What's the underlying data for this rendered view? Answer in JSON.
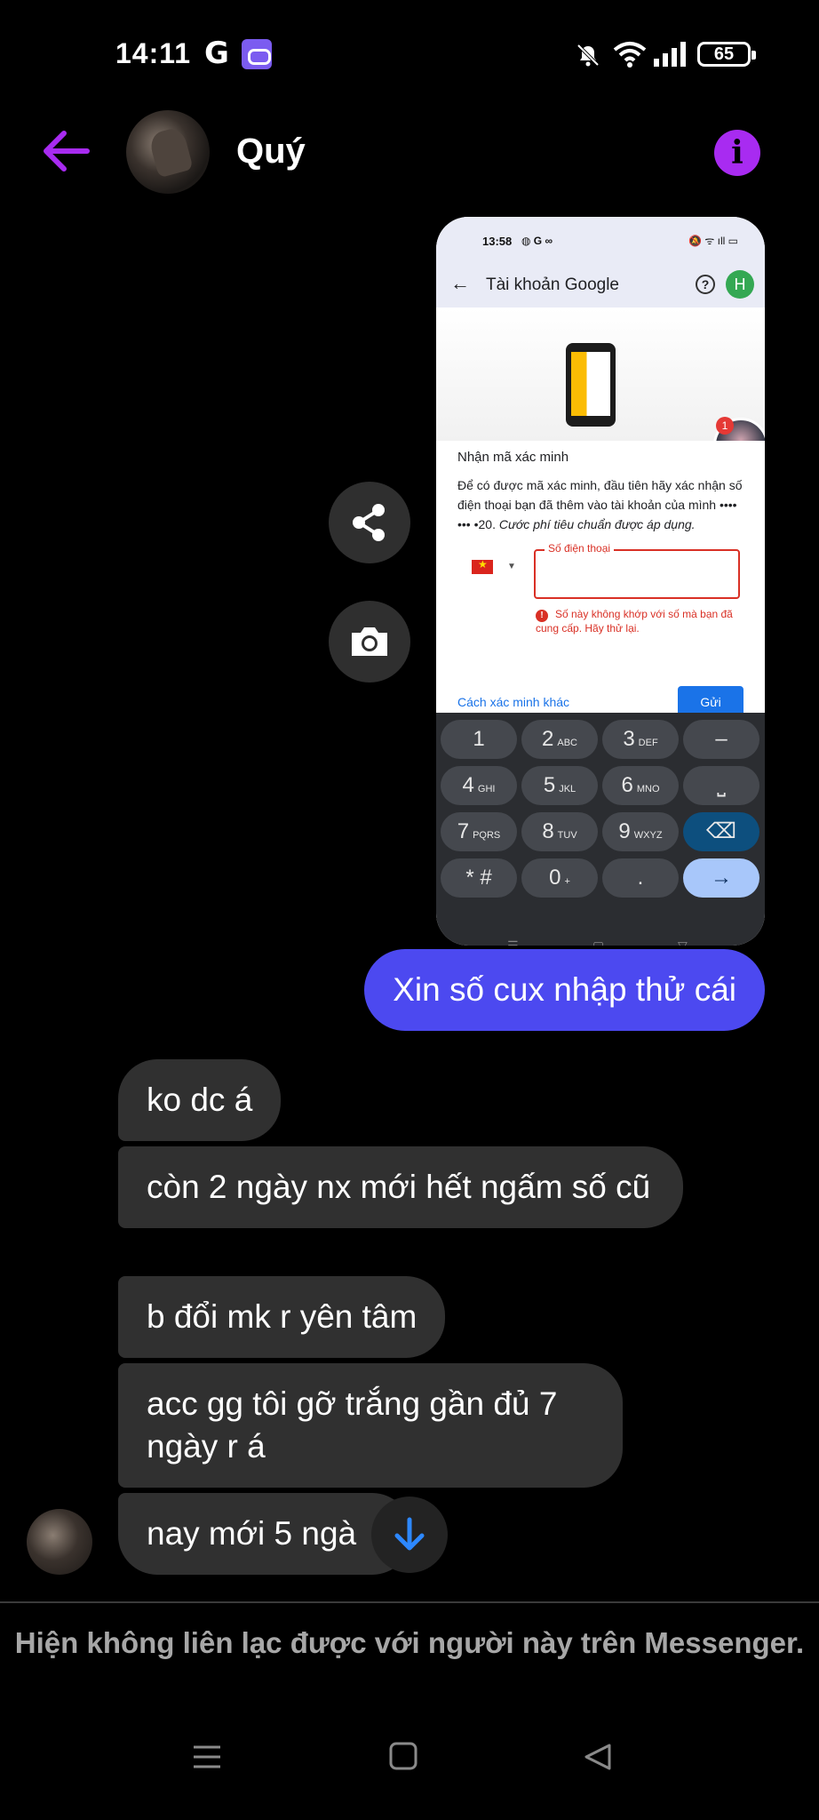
{
  "status_bar": {
    "time": "14:11",
    "g_label": "G",
    "battery": "65"
  },
  "header": {
    "contact_name": "Quý",
    "info_label": "i"
  },
  "shared_image": {
    "status_time": "13:58",
    "status_icons": "◍ G ∞",
    "status_right": "🔕 ᯤ ıll ▭",
    "appbar_back": "←",
    "appbar_title": "Tài khoản Google",
    "help_label": "?",
    "account_initial": "H",
    "bubble_count": "1",
    "heading": "Nhận mã xác minh",
    "body_text": "Để có được mã xác minh, đầu tiên hãy xác nhận số điện thoại bạn đã thêm vào tài khoản của mình •••• ••• •20.",
    "body_italic": "Cước phí tiêu chuẩn được áp dụng.",
    "phone_field_label": "Số điện thoại",
    "error_text": "Số này không khớp với số mà bạn đã cung cấp. Hãy thử lại.",
    "other_method": "Cách xác minh khác",
    "send_label": "Gửi",
    "keys": [
      {
        "main": "1",
        "sub": ""
      },
      {
        "main": "2",
        "sub": "ABC"
      },
      {
        "main": "3",
        "sub": "DEF"
      },
      {
        "main": "–",
        "sub": ""
      },
      {
        "main": "4",
        "sub": "GHI"
      },
      {
        "main": "5",
        "sub": "JKL"
      },
      {
        "main": "6",
        "sub": "MNO"
      },
      {
        "main": "⎵",
        "sub": ""
      },
      {
        "main": "7",
        "sub": "PQRS"
      },
      {
        "main": "8",
        "sub": "TUV"
      },
      {
        "main": "9",
        "sub": "WXYZ"
      },
      {
        "main": "⌫",
        "sub": ""
      },
      {
        "main": "* #",
        "sub": ""
      },
      {
        "main": "0",
        "sub": "+"
      },
      {
        "main": ".",
        "sub": ""
      },
      {
        "main": "→",
        "sub": ""
      }
    ],
    "nav_menu": "☰",
    "nav_home": "▢",
    "nav_back": "▽"
  },
  "messages": {
    "outgoing": "Xin số cux nhập thử cái",
    "incoming": [
      "ko dc á",
      "còn 2 ngày nx mới hết ngấm số cũ",
      "b đổi mk r yên tâm",
      "acc gg tôi gỡ trắng gần đủ 7 ngày r á",
      "nay mới 5 ngà"
    ]
  },
  "notice": "Hiện không liên lạc được với người này trên Messenger.",
  "icons": {
    "back": "arrow-left-icon",
    "info": "info-icon",
    "share": "share-icon",
    "camera": "camera-icon",
    "scroll_down": "arrow-down-icon"
  },
  "colors": {
    "accent": "#a82bf1",
    "outgoing_bubble": "#4c49f0",
    "incoming_bubble": "#303030",
    "scroll_arrow": "#2d88ff"
  }
}
